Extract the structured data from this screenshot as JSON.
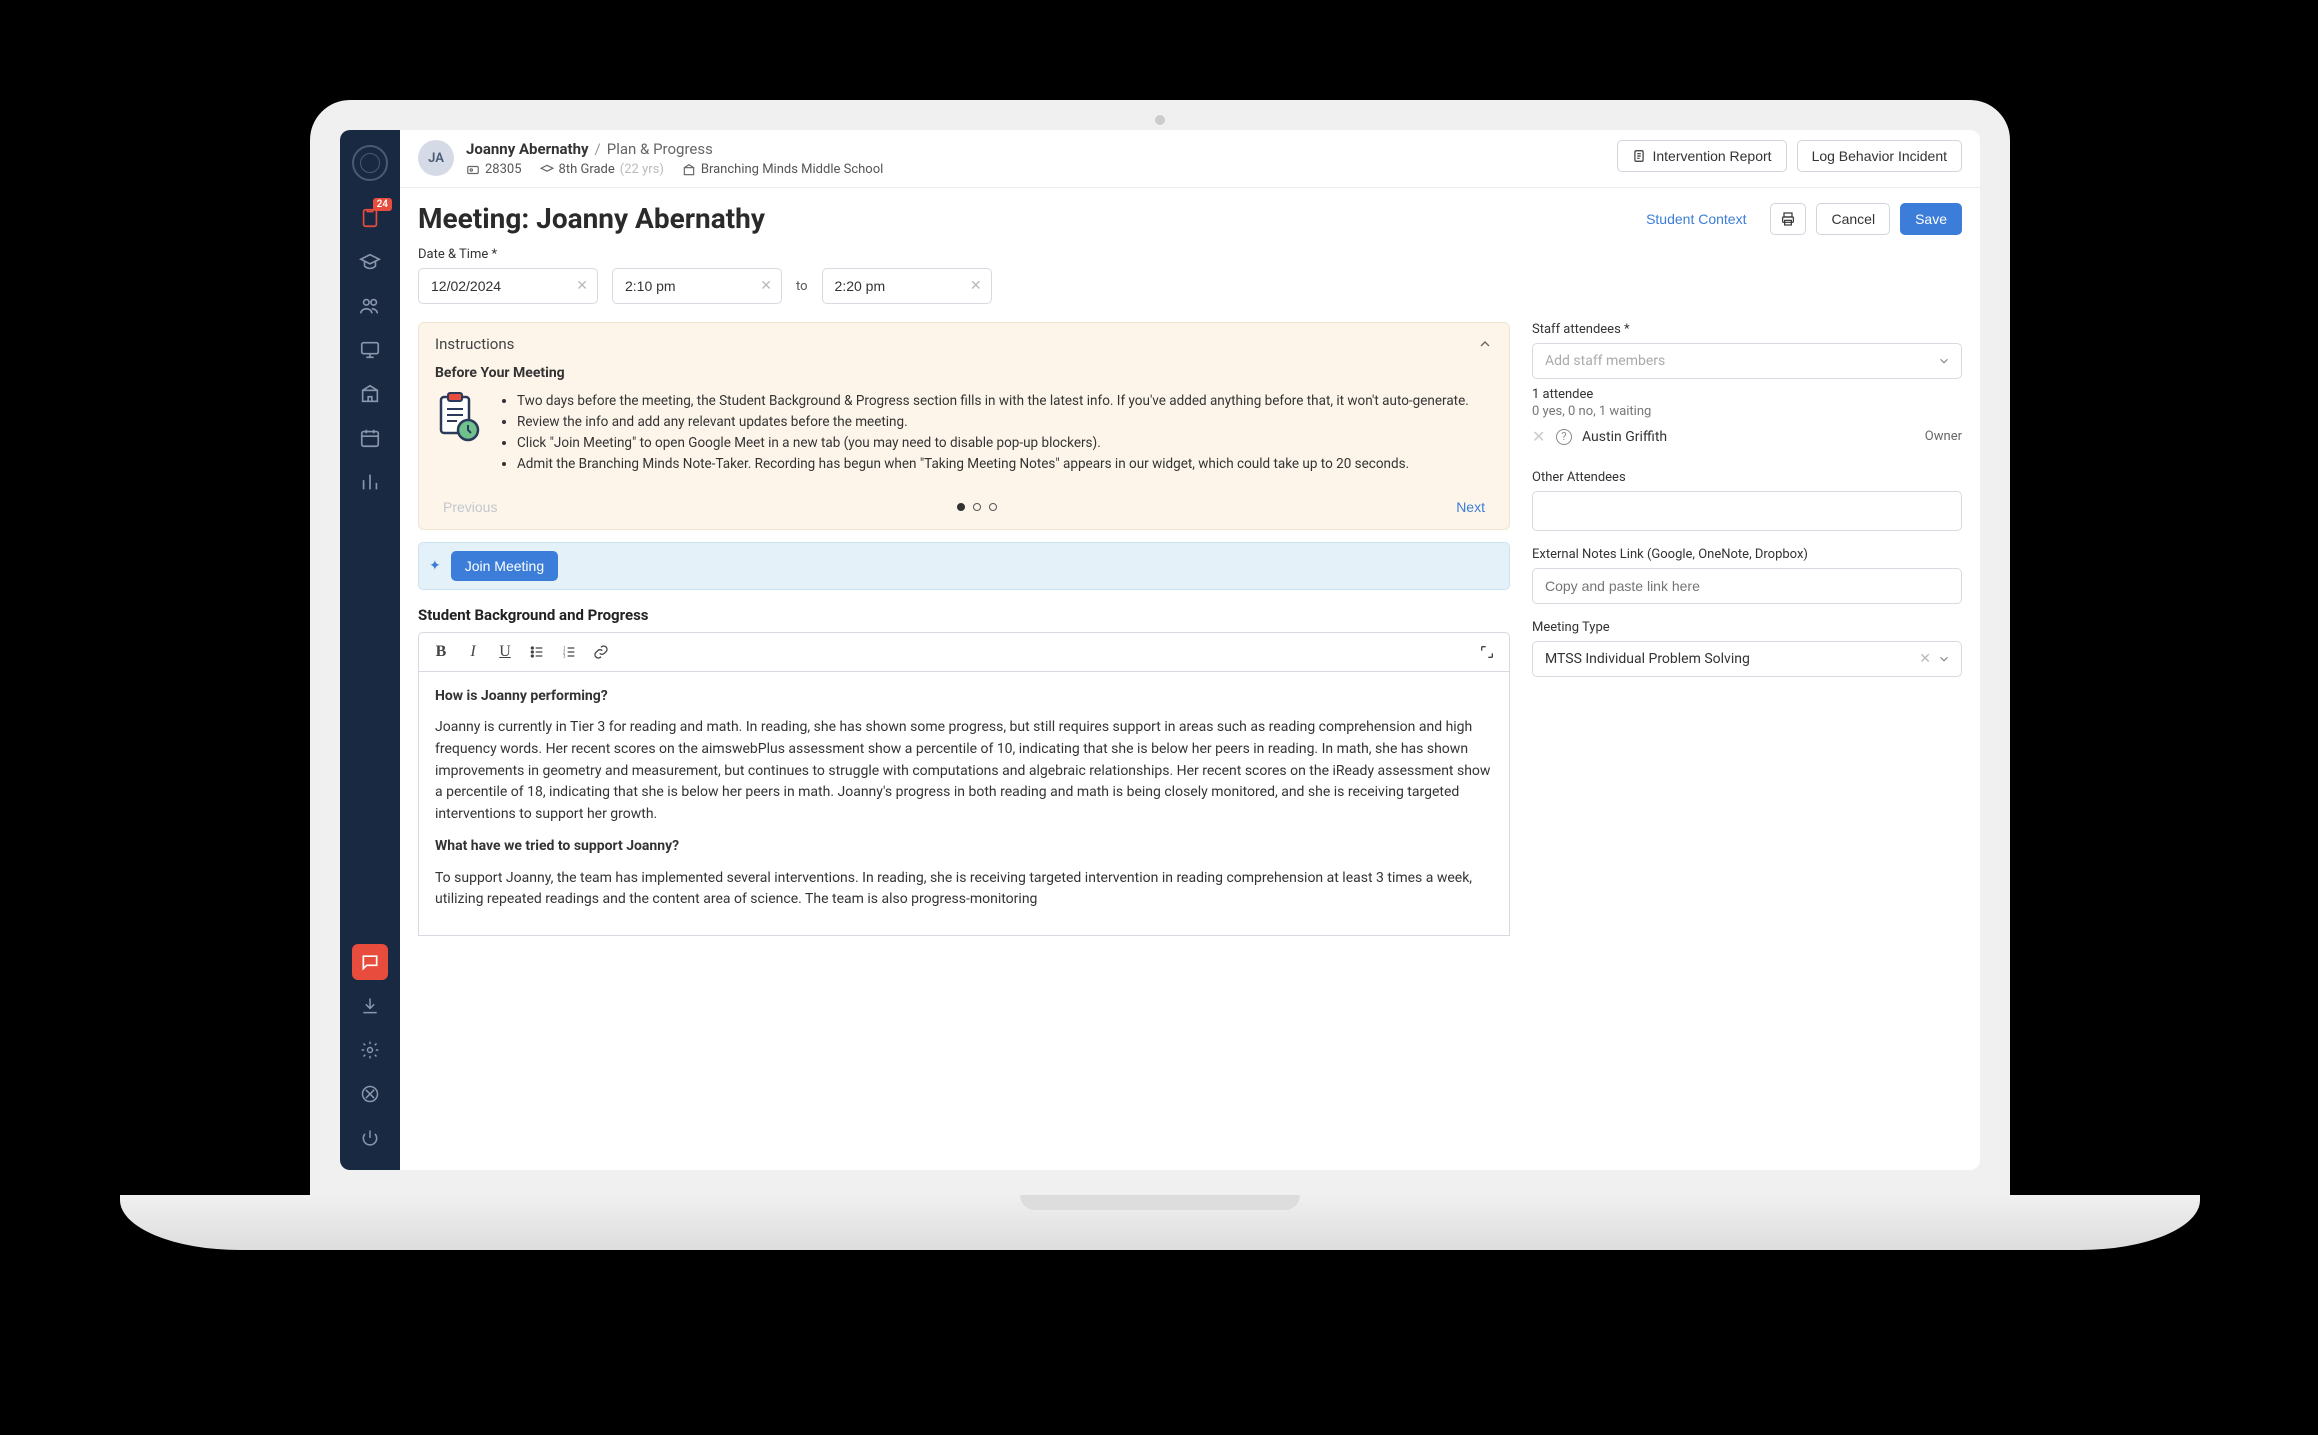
{
  "sidebar": {
    "badge": "24"
  },
  "breadcrumb": {
    "avatar": "JA",
    "student_name": "Joanny Abernathy",
    "page": "Plan & Progress",
    "id": "28305",
    "grade": "8th Grade",
    "age": "(22 yrs)",
    "school": "Branching Minds Middle School"
  },
  "topbar": {
    "intervention_report": "Intervention Report",
    "log_behavior": "Log Behavior Incident"
  },
  "page": {
    "title": "Meeting: Joanny Abernathy",
    "student_context": "Student Context",
    "cancel": "Cancel",
    "save": "Save"
  },
  "datetime": {
    "label": "Date & Time *",
    "date": "12/02/2024",
    "start": "2:10 pm",
    "to": "to",
    "end": "2:20 pm"
  },
  "instructions": {
    "header": "Instructions",
    "subtitle": "Before Your Meeting",
    "bullets": [
      "Two days before the meeting, the Student Background & Progress section fills in with the latest info. If you've added anything before that, it won't auto-generate.",
      "Review the info and add any relevant updates before the meeting.",
      "Click \"Join Meeting\" to open Google Meet in a new tab (you may need to disable pop-up blockers).",
      "Admit the Branching Minds Note-Taker. Recording has begun when \"Taking Meeting Notes\" appears in our widget, which could take up to 20 seconds."
    ],
    "prev": "Previous",
    "next": "Next"
  },
  "join": {
    "label": "Join Meeting"
  },
  "editor": {
    "title": "Student Background and Progress",
    "q1": "How is Joanny performing?",
    "p1": "Joanny is currently in Tier 3 for reading and math. In reading, she has shown some progress, but still requires support in areas such as reading comprehension and high frequency words. Her recent scores on the aimswebPlus assessment show a percentile of 10, indicating that she is below her peers in reading. In math, she has shown improvements in geometry and measurement, but continues to struggle with computations and algebraic relationships. Her recent scores on the iReady assessment show a percentile of 18, indicating that she is below her peers in math. Joanny's progress in both reading and math is being closely monitored, and she is receiving targeted interventions to support her growth.",
    "q2": "What have we tried to support Joanny?",
    "p2": "To support Joanny, the team has implemented several interventions. In reading, she is receiving targeted intervention in reading comprehension at least 3 times a week, utilizing repeated readings and the content area of science. The team is also progress-monitoring"
  },
  "right": {
    "staff_label": "Staff attendees *",
    "staff_placeholder": "Add staff members",
    "attendee_count": "1 attendee",
    "attendee_status": "0 yes, 0 no, 1 waiting",
    "attendee_name": "Austin Griffith",
    "attendee_role": "Owner",
    "other_label": "Other Attendees",
    "notes_label": "External Notes Link (Google, OneNote, Dropbox)",
    "notes_placeholder": "Copy and paste link here",
    "type_label": "Meeting Type",
    "type_value": "MTSS Individual Problem Solving"
  }
}
